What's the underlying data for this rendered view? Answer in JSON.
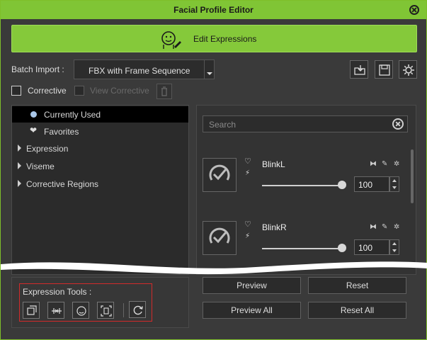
{
  "window": {
    "title": "Facial Profile Editor"
  },
  "edit_button": {
    "label": "Edit Expressions"
  },
  "batch": {
    "label": "Batch Import :",
    "value": "FBX with Frame Sequence"
  },
  "checks": {
    "corrective": "Corrective",
    "view_corrective": "View Corrective"
  },
  "tree": {
    "items": [
      {
        "label": "Currently Used"
      },
      {
        "label": "Favorites"
      },
      {
        "label": "Expression"
      },
      {
        "label": "Viseme"
      },
      {
        "label": "Corrective Regions"
      }
    ]
  },
  "search": {
    "placeholder": "Search"
  },
  "expressions": [
    {
      "name": "BlinkL",
      "value": "100"
    },
    {
      "name": "BlinkR",
      "value": "100"
    }
  ],
  "tools": {
    "label": "Expression Tools :"
  },
  "buttons": {
    "preview": "Preview",
    "reset": "Reset",
    "preview_all": "Preview All",
    "reset_all": "Reset All"
  },
  "colors": {
    "accent": "#80c535",
    "tool_highlight": "#d22a2a"
  }
}
